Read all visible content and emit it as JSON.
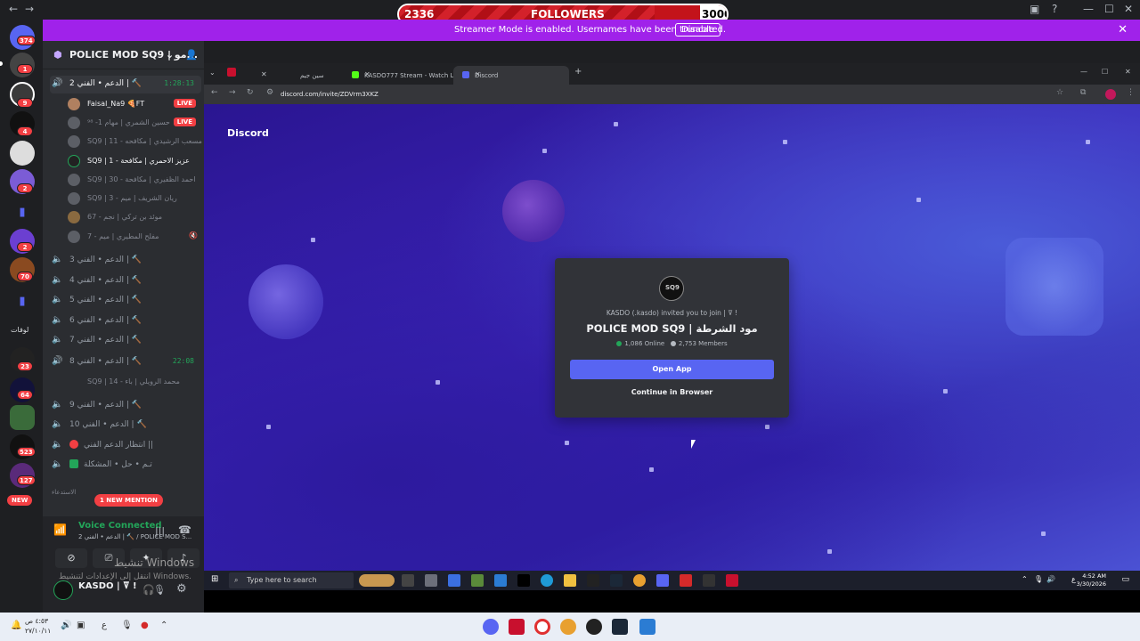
{
  "followers_bar": {
    "current": "2336",
    "label": "FOLLOWERS",
    "goal": "3000",
    "progress": 0.7787
  },
  "streamer_banner": {
    "message": "Streamer Mode is enabled. Usernames have been truncated.",
    "disable_label": "Disable"
  },
  "server_rail": {
    "badges": [
      "374",
      "1",
      "9",
      "4",
      "2",
      "2",
      "70",
      "23",
      "64",
      "523",
      "127"
    ],
    "new_label": "NEW",
    "folder_label": "لوفات"
  },
  "channel_panel": {
    "server_name": "POLICE MOD SQ9 | مو...",
    "voice_channels": [
      {
        "name": "الدعم • الفني 2 | 🔨",
        "time": "1:28:13",
        "active": true
      },
      {
        "name": "الدعم • الفني 3 | 🔨"
      },
      {
        "name": "الدعم • الفني 4 | 🔨"
      },
      {
        "name": "الدعم • الفني 5 | 🔨"
      },
      {
        "name": "الدعم • الفني 6 | 🔨"
      },
      {
        "name": "الدعم • الفني 7 | 🔨"
      },
      {
        "name": "الدعم • الفني 8 | 🔨",
        "time": "22:08",
        "active": true
      },
      {
        "name": "الدعم • الفني 9 | 🔨"
      },
      {
        "name": "الدعم • الفني 10 | 🔨"
      },
      {
        "name": "انتظار الدعم الفني ||"
      },
      {
        "name": "تـم • حل • المشكلة"
      }
    ],
    "users": [
      {
        "name": "Faisal_Na9 🍕FT",
        "live": true
      },
      {
        "name": "حسين الشمري | مهام 1- ⁹⁸",
        "live": true
      },
      {
        "name": "SQ9 | مسعب الرشيدي | مكافحه - 11"
      },
      {
        "name": "SQ9 | عزيز الاحمري | مكافحة - 1"
      },
      {
        "name": "SQ9 | احمد الظفيري | مكافحة - 30"
      },
      {
        "name": "SQ9 | ريان الشريف | ميم - 3"
      },
      {
        "name": "موئد بن تركي | نجم - 67"
      },
      {
        "name": "مفلح المطيري | ميم - 7"
      }
    ],
    "user_under_8": "SQ9 | محمد الرويلي | باء - 14",
    "category_label": "الاستدعاء",
    "live_label": "LIVE",
    "mention_label": "1 NEW MENTION"
  },
  "voice_panel": {
    "status": "Voice Connected",
    "channel": "الدعم • الفني 2 | 🔨 / POLICE MOD S...",
    "username": "KASDO | ꘜ !"
  },
  "windows_watermark": {
    "line1": "تنشيط Windows",
    "line2": "انتقل إلى الإعدادات لتنشيط Windows."
  },
  "browser": {
    "tabs": [
      {
        "title": "سين جيم",
        "active": false
      },
      {
        "title": "KASDO777 Stream - Watch Live...",
        "active": false
      },
      {
        "title": "Discord",
        "active": true
      }
    ],
    "url": "discord.com/invite/ZDVrm3XKZ",
    "logo": "Discord"
  },
  "invite_card": {
    "inviter": "KASDO (.kasdo) invited you to join | ꘜ !",
    "server_title": "POLICE MOD SQ9 | مود الشرطة",
    "online": "1,086 Online",
    "members": "2,753 Members",
    "open_label": "Open App",
    "browser_label": "Continue in Browser",
    "icon_text": "SQ9"
  },
  "inner_taskbar": {
    "search_placeholder": "Type here to search",
    "time": "4:52 AM",
    "date": "3/30/2026",
    "lang": "ع"
  },
  "outer_taskbar": {
    "time": "٤:٥٣ ص",
    "date": "٢٧/١٠/١١",
    "lang": "ع"
  }
}
